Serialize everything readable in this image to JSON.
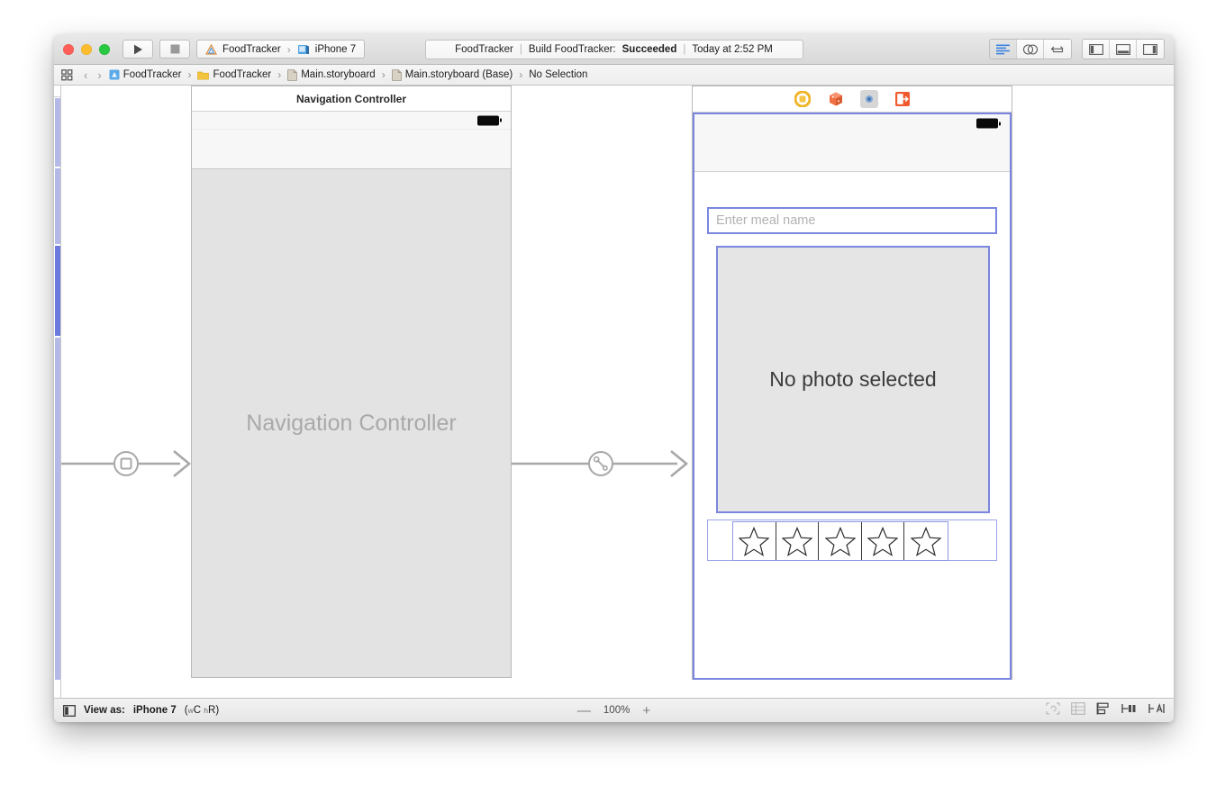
{
  "window": {
    "traffic_lights": [
      "close",
      "minimize",
      "zoom"
    ],
    "toolbar": {
      "run_label": "Run",
      "stop_label": "Stop",
      "scheme_project": "FoodTracker",
      "scheme_separator": "›",
      "scheme_destination": "iPhone 7",
      "status": {
        "project": "FoodTracker",
        "sep": "|",
        "action_prefix": "Build FoodTracker:",
        "action_result": "Succeeded",
        "timestamp": "Today at 2:52 PM"
      },
      "editor_modes": [
        {
          "name": "standard-editor",
          "active": true
        },
        {
          "name": "assistant-editor",
          "active": false
        },
        {
          "name": "version-editor",
          "active": false
        }
      ],
      "view_toggles": [
        {
          "name": "navigator-toggle",
          "active": false
        },
        {
          "name": "debug-area-toggle",
          "active": false
        },
        {
          "name": "utilities-toggle",
          "active": false
        }
      ]
    },
    "jumpbar": {
      "back_label": "‹",
      "forward_label": "›",
      "separator": "›",
      "items": [
        {
          "label": "FoodTracker",
          "icon": "project-icon"
        },
        {
          "label": "FoodTracker",
          "icon": "folder-icon"
        },
        {
          "label": "Main.storyboard",
          "icon": "storyboard-icon"
        },
        {
          "label": "Main.storyboard (Base)",
          "icon": "storyboard-icon"
        },
        {
          "label": "No Selection",
          "icon": "none"
        }
      ]
    }
  },
  "canvas": {
    "nav_scene": {
      "title": "Navigation Controller",
      "content_label": "Navigation Controller"
    },
    "meal_scene": {
      "dock_icons": [
        {
          "name": "view-controller-icon",
          "selected": false
        },
        {
          "name": "first-responder-icon",
          "selected": false
        },
        {
          "name": "exit-icon",
          "selected": true
        },
        {
          "name": "unwind-segue-icon",
          "selected": false
        }
      ],
      "name_textfield": {
        "placeholder": "Enter meal name",
        "value": ""
      },
      "photo_image_view": {
        "label": "No photo selected"
      },
      "rating_control": {
        "star_count": 5,
        "filled": 0,
        "star_glyph": "☆"
      }
    },
    "segues": [
      {
        "name": "initial-view-controller-arrow",
        "glyph": "entry-point-icon"
      },
      {
        "name": "relationship-segue-arrow",
        "glyph": "root-view-controller-icon"
      }
    ]
  },
  "bottombar": {
    "view_as_prefix": "View as:",
    "view_as_device": "iPhone 7",
    "trait_open": "(",
    "trait_width_sub": "w",
    "trait_width": "C",
    "trait_height_sub": "h",
    "trait_height": "R",
    "trait_close": ")",
    "zoom_out": "—",
    "zoom_level": "100%",
    "zoom_in": "+",
    "autolayout_icons": [
      {
        "name": "update-frames-icon",
        "dim": true
      },
      {
        "name": "embed-in-icon",
        "dim": true
      },
      {
        "name": "align-icon",
        "dim": false
      },
      {
        "name": "pin-icon",
        "dim": false
      },
      {
        "name": "resolve-issues-icon",
        "dim": false
      }
    ]
  }
}
